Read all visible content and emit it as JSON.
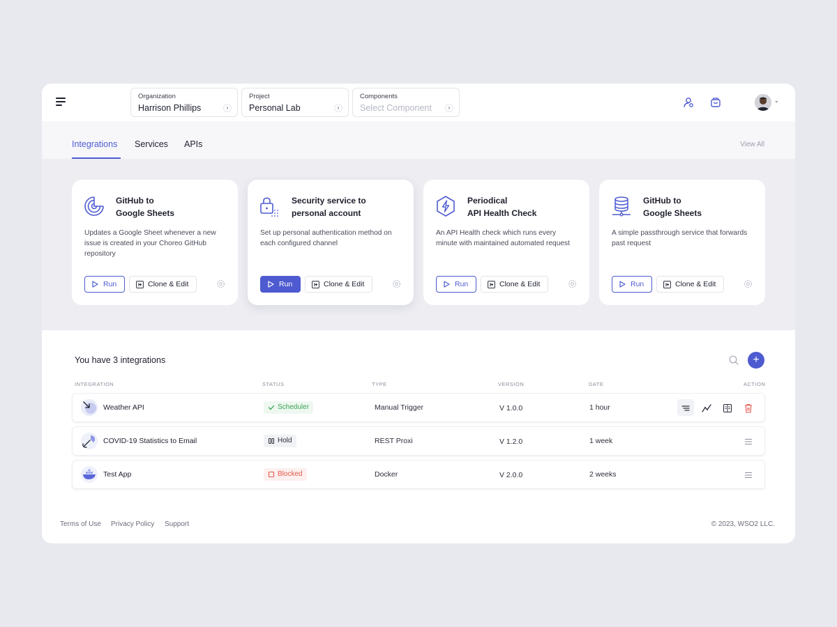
{
  "topbar": {
    "organization": {
      "label": "Organization",
      "value": "Harrison Phillips"
    },
    "project": {
      "label": "Project",
      "value": "Personal Lab"
    },
    "components": {
      "label": "Components",
      "placeholder": "Select Component"
    },
    "icons": [
      "menu-icon",
      "user-settings-icon",
      "shopping-bag-icon",
      "avatar",
      "chevron-down-icon"
    ]
  },
  "tabs": {
    "items": [
      {
        "label": "Integrations",
        "active": true
      },
      {
        "label": "Services",
        "active": false
      },
      {
        "label": "APIs",
        "active": false
      }
    ],
    "view_all": "View All"
  },
  "cards": [
    {
      "title": "GitHub to\nGoogle Sheets",
      "description": "Updates a Google Sheet whenever a new issue is created in your Choreo GitHub repository",
      "icon": "radar-icon",
      "run_label": "Run",
      "clone_label": "Clone & Edit"
    },
    {
      "title": "Security service to\npersonal account",
      "description": "Set up personal authentication method on each configured channel",
      "icon": "lock-icon",
      "run_label": "Run",
      "clone_label": "Clone & Edit"
    },
    {
      "title": "Periodical\nAPI Health Check",
      "description": "An API Health check which runs every minute with maintained automated request",
      "icon": "lightning-hexagon-icon",
      "run_label": "Run",
      "clone_label": "Clone & Edit"
    },
    {
      "title": "GitHub to\nGoogle Sheets",
      "description": "A simple passthrough service that forwards past request",
      "icon": "database-icon",
      "run_label": "Run",
      "clone_label": "Clone & Edit"
    }
  ],
  "list": {
    "title": "You have 3 integrations",
    "headers": {
      "integration": "INTEGRATION",
      "status": "STATUS",
      "type": "TYPE",
      "version": "VERSION",
      "date": "DATE",
      "action": "ACTION"
    },
    "rows": [
      {
        "name": "Weather API",
        "status": "Scheduler",
        "type": "Manual Trigger",
        "version": "V 1.0.0",
        "date": "1 hour"
      },
      {
        "name": "COVID-19 Statistics to Email",
        "status": "Hold",
        "type": "REST Proxi",
        "version": "V 1.2.0",
        "date": "1 week"
      },
      {
        "name": "Test App",
        "status": "Blocked",
        "type": "Docker",
        "version": "V 2.0.0",
        "date": "2 weeks"
      }
    ]
  },
  "footer": {
    "links": [
      "Terms of Use",
      "Privacy Policy",
      "Support"
    ],
    "copyright": "© 2023, WSO2 LLC."
  },
  "colors": {
    "accent": "#4e5bd0",
    "scheduler": "#3aa356",
    "blocked": "#e2574c"
  }
}
